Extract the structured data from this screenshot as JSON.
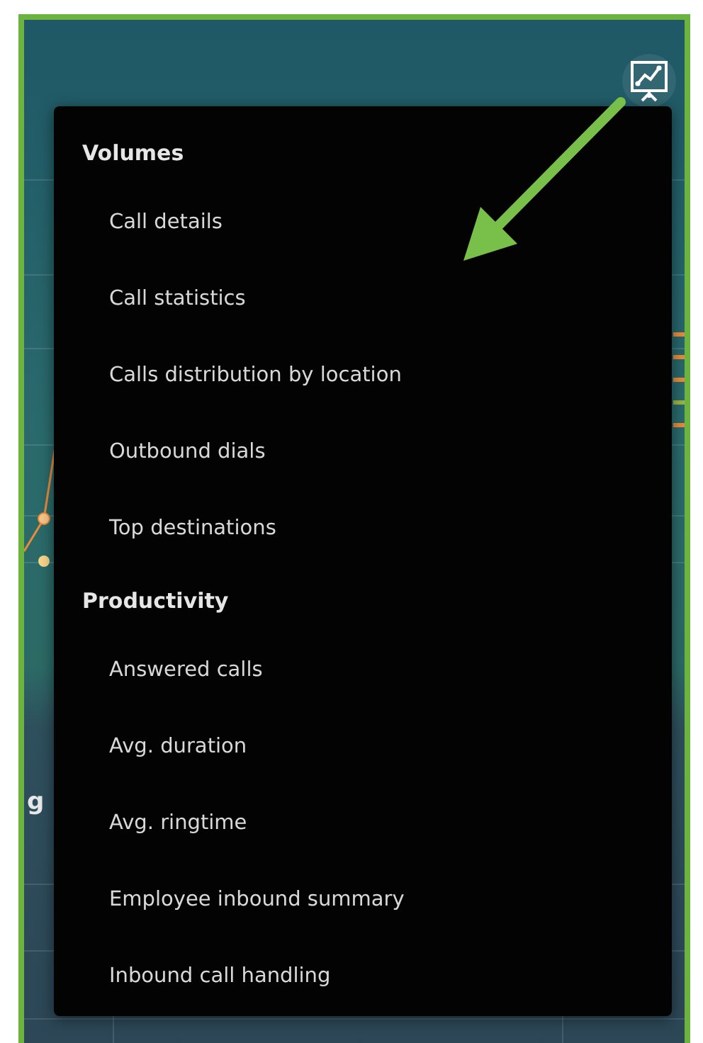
{
  "background": {
    "section_title": "g"
  },
  "menu": {
    "groups": [
      {
        "title": "Volumes",
        "items": [
          {
            "label": "Call details"
          },
          {
            "label": "Call statistics"
          },
          {
            "label": "Calls distribution by location"
          },
          {
            "label": "Outbound dials"
          },
          {
            "label": "Top destinations"
          }
        ]
      },
      {
        "title": "Productivity",
        "items": [
          {
            "label": "Answered calls"
          },
          {
            "label": "Avg. duration"
          },
          {
            "label": "Avg. ringtime"
          },
          {
            "label": "Employee inbound summary"
          },
          {
            "label": "Inbound call handling"
          }
        ]
      }
    ]
  }
}
